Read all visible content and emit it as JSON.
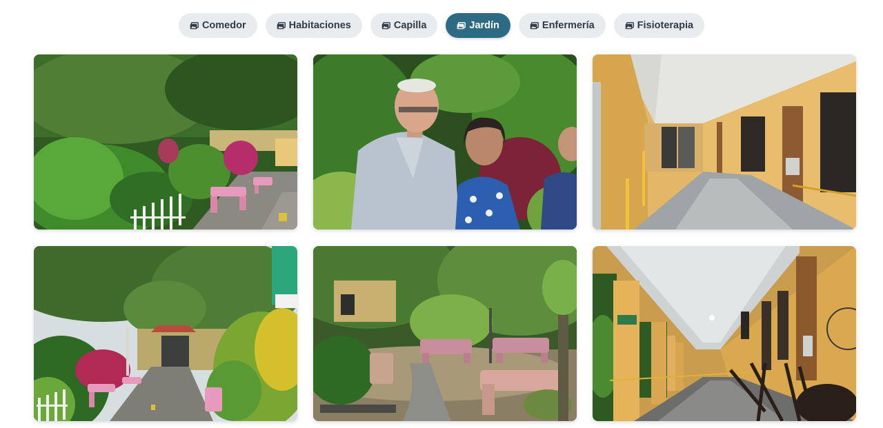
{
  "tabs": [
    {
      "label": "Comedor",
      "icon": "images-icon",
      "active": false
    },
    {
      "label": "Habitaciones",
      "icon": "images-icon",
      "active": false
    },
    {
      "label": "Capilla",
      "icon": "images-icon",
      "active": false
    },
    {
      "label": "Jardín",
      "icon": "images-icon",
      "active": true
    },
    {
      "label": "Enfermería",
      "icon": "images-icon",
      "active": false
    },
    {
      "label": "Fisioterapia",
      "icon": "images-icon",
      "active": false
    }
  ],
  "colors": {
    "active_tab": "#2d6b85",
    "inactive_tab": "#e9ecef",
    "inactive_text": "#2f3b47"
  },
  "gallery": {
    "photos": [
      {
        "subject": "garden path with pink benches and white fence"
      },
      {
        "subject": "elderly couple smiling in tropical garden"
      },
      {
        "subject": "yellow corridor with wooden doors"
      },
      {
        "subject": "garden walkway with pink benches and shrubs"
      },
      {
        "subject": "garden with pink benches and stone path"
      },
      {
        "subject": "covered corridor with rocking chairs"
      }
    ]
  }
}
